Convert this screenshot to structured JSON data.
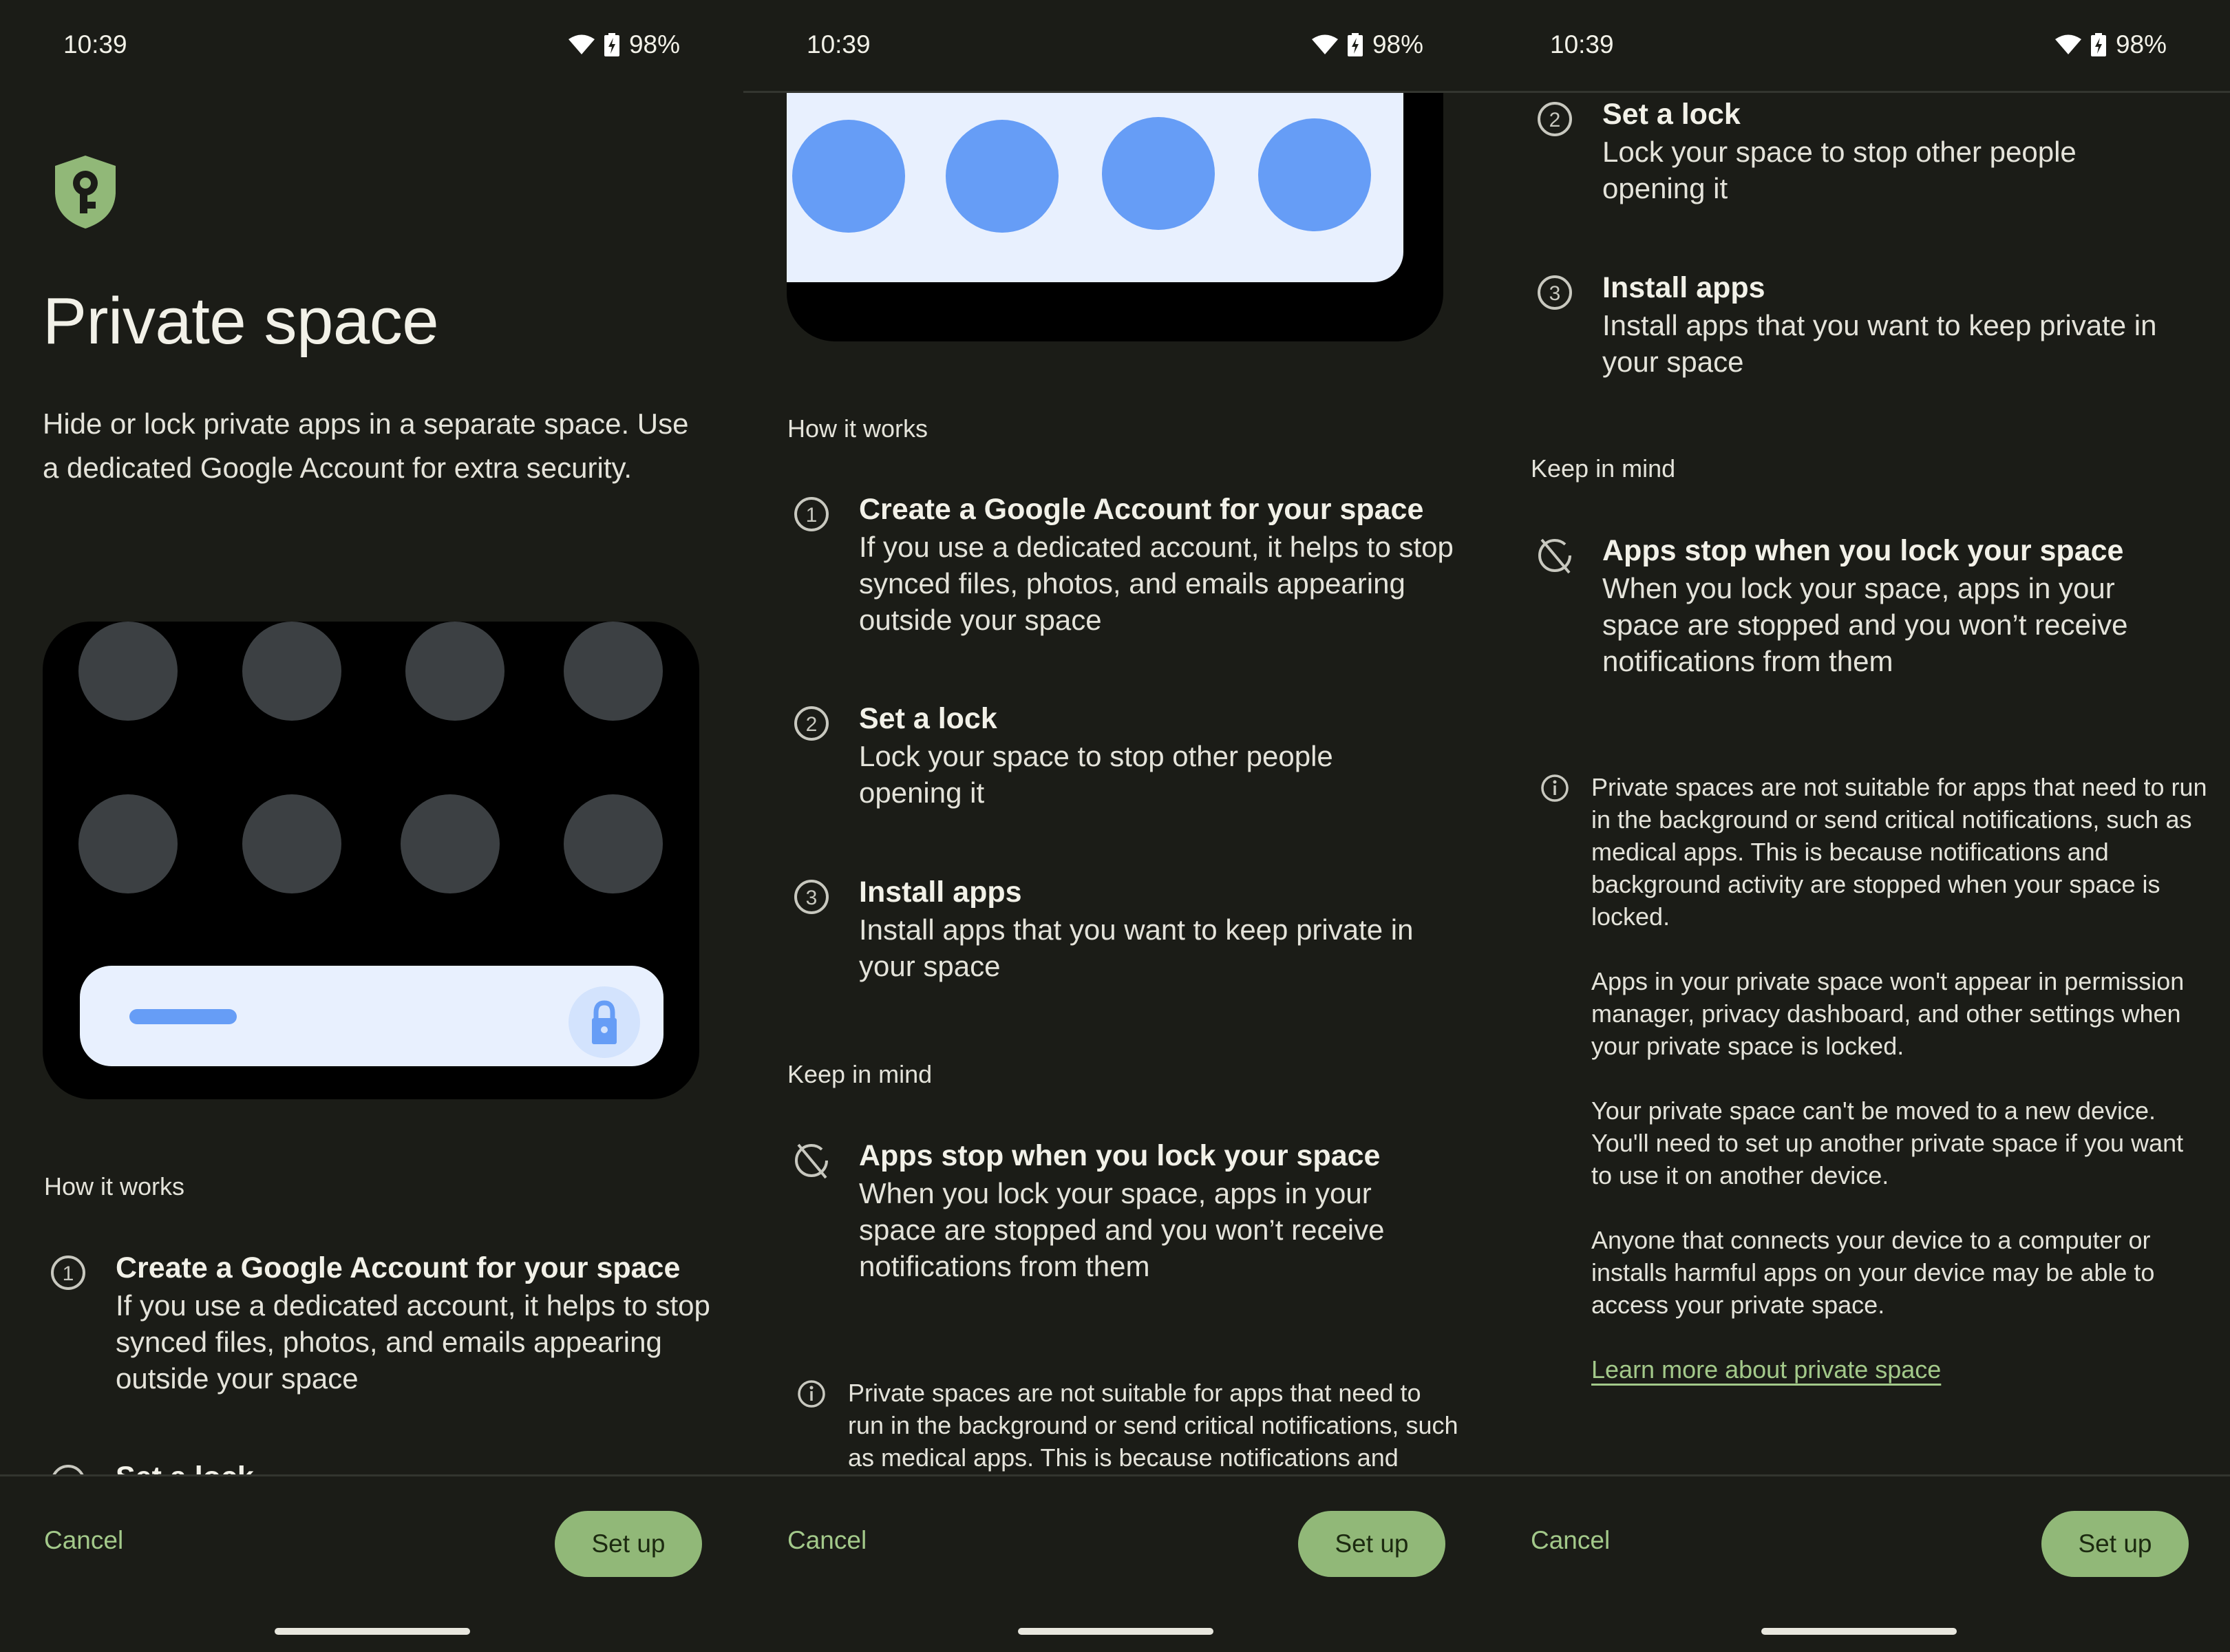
{
  "status_bar": {
    "time": "10:39",
    "battery_percent": "98%",
    "icons": [
      "wifi-icon",
      "battery-charging-icon"
    ]
  },
  "page": {
    "title": "Private space",
    "description": "Hide or lock private apps in a separate space. Use a dedicated Google Account for extra security.",
    "icon": "shield-key-icon"
  },
  "how_it_works": {
    "heading": "How it works",
    "steps": [
      {
        "number": "1",
        "title": "Create a Google Account for your space",
        "body": "If you use a dedicated account, it helps to stop synced files, photos, and emails appearing outside your space"
      },
      {
        "number": "2",
        "title": "Set a lock",
        "body": "Lock your space to stop other people opening it"
      },
      {
        "number": "3",
        "title": "Install apps",
        "body": "Install apps that you want to keep private in your space"
      }
    ]
  },
  "keep_in_mind": {
    "heading": "Keep in mind",
    "items": [
      {
        "icon": "apps-stop-icon",
        "title": "Apps stop when you lock your space",
        "body": "When you lock your space, apps in your space are stopped and you won’t receive notifications from them"
      }
    ]
  },
  "info": {
    "icon": "info-icon",
    "paragraphs": [
      "Private spaces are not suitable for apps that need to run in the background or send critical notifications, such as medical apps. This is because notifications and background activity are stopped when your space is locked.",
      "Apps in your private space won't appear in permission manager, privacy dashboard, and other settings when your private space is locked.",
      "Your private space can't be moved to a new device. You'll need to set up another private space if you want to use it on another device.",
      "Anyone that connects your device to a computer or installs harmful apps on your device may be able to access your private space."
    ],
    "link": "Learn more about private space"
  },
  "footer": {
    "cancel_label": "Cancel",
    "setup_label": "Set up"
  },
  "colors": {
    "background": "#1b1c17",
    "accent": "#a3c98a",
    "button_fill": "#91b878",
    "illustration_blue": "#669df6",
    "illustration_light": "#e8f0fe"
  }
}
